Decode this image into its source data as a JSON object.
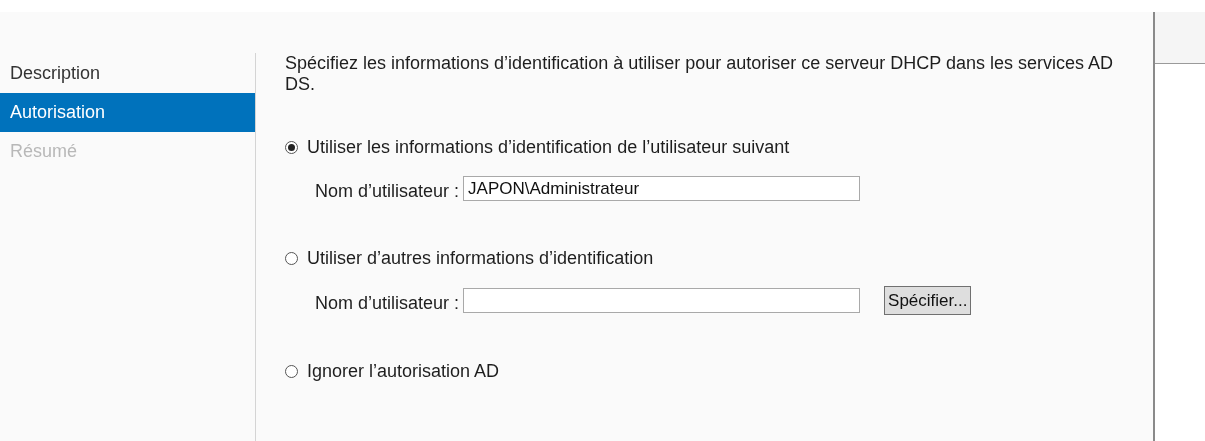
{
  "sidebar": {
    "items": [
      {
        "label": "Description",
        "selected": false,
        "disabled": false
      },
      {
        "label": "Autorisation",
        "selected": true,
        "disabled": false
      },
      {
        "label": "Résumé",
        "selected": false,
        "disabled": true
      }
    ]
  },
  "intro": "Spécifiez les informations d’identification à utiliser pour autoriser ce serveur DHCP dans les services AD DS.",
  "options": [
    {
      "label": "Utiliser les informations d’identification de l’utilisateur suivant",
      "selected": true,
      "field": {
        "label": "Nom d’utilisateur :",
        "value": "JAPON\\Administrateur"
      }
    },
    {
      "label": "Utiliser d’autres informations d’identification",
      "selected": false,
      "field": {
        "label": "Nom d’utilisateur :"
      },
      "button": "Spécifier..."
    },
    {
      "label": "Ignorer l’autorisation AD",
      "selected": false
    }
  ]
}
